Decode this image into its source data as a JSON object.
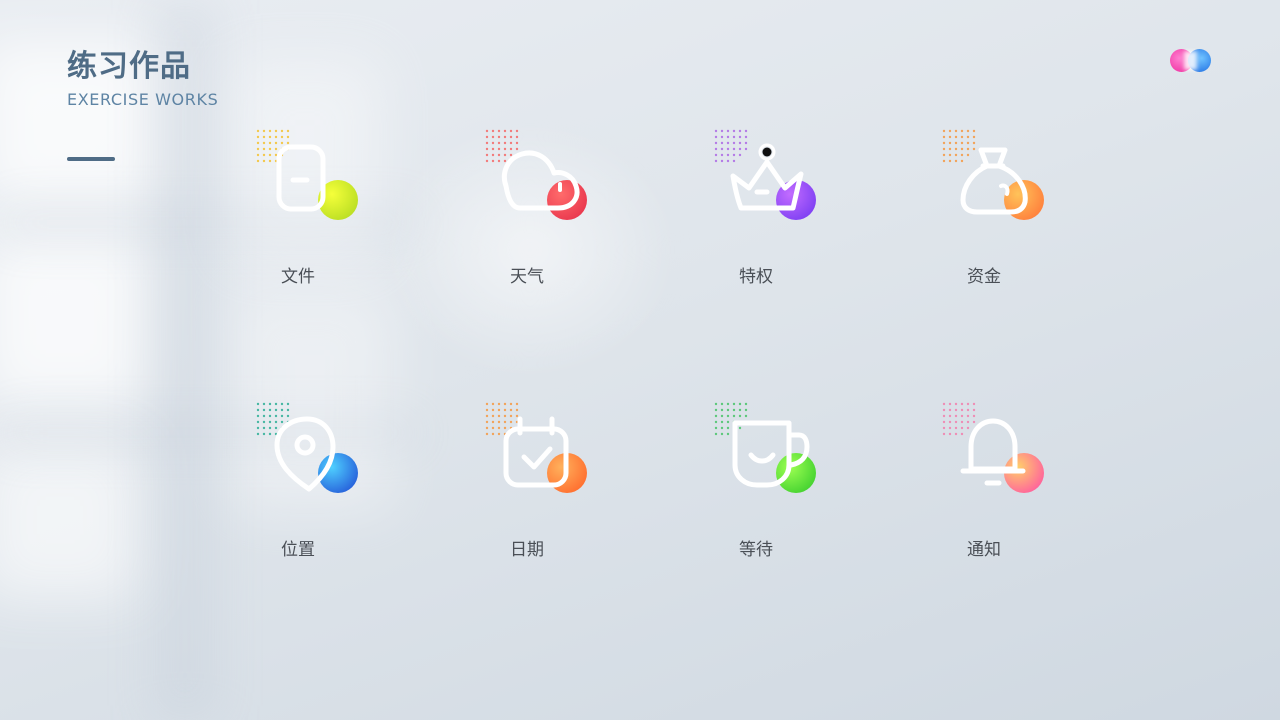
{
  "header": {
    "title": "练习作品",
    "subtitle": "EXERCISE WORKS"
  },
  "colors": {
    "title": "#4f6c86",
    "subtitle": "#5e84a4",
    "label": "#4a4f56"
  },
  "icons": [
    {
      "label": "文件",
      "icon": "file-icon",
      "blob": [
        "#f5ff3a",
        "#b6dc22"
      ],
      "dots": "#f3c84d"
    },
    {
      "label": "天气",
      "icon": "cloud-icon",
      "blob": [
        "#ff6b6b",
        "#e8344c"
      ],
      "dots": "#f27b7b"
    },
    {
      "label": "特权",
      "icon": "crown-icon",
      "blob": [
        "#c26cff",
        "#7a3df2"
      ],
      "dots": "#b47be6"
    },
    {
      "label": "资金",
      "icon": "money-bag-icon",
      "blob": [
        "#ffc35a",
        "#ff7b3a"
      ],
      "dots": "#f2a35a"
    },
    {
      "label": "位置",
      "icon": "location-pin-icon",
      "blob": [
        "#4fd0ff",
        "#2459d8"
      ],
      "dots": "#47b7a3"
    },
    {
      "label": "日期",
      "icon": "calendar-icon",
      "blob": [
        "#ffb15c",
        "#ff6a2c"
      ],
      "dots": "#f2a35a"
    },
    {
      "label": "等待",
      "icon": "cup-icon",
      "blob": [
        "#9dff52",
        "#3ecf2e"
      ],
      "dots": "#5cc87a"
    },
    {
      "label": "通知",
      "icon": "bell-icon",
      "blob": [
        "#ffd06a",
        "#ff5aa0"
      ],
      "dots": "#ef8db5"
    }
  ]
}
